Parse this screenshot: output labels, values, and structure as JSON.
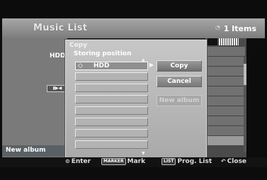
{
  "header": {
    "title": "Music List",
    "items_count": "1 Items"
  },
  "left": {
    "hdd": "HDD",
    "new_album": "New album"
  },
  "dialog": {
    "title": "Copy",
    "subtitle": "Storing position",
    "slots": [
      {
        "label": "HDD",
        "icon": "hdd-icon",
        "selected": true
      }
    ],
    "buttons": {
      "copy": "Copy",
      "cancel": "Cancel",
      "new_album": "New album"
    }
  },
  "footer": {
    "enter": "Enter",
    "mark_key": "MARKER",
    "mark": "Mark",
    "list_key": "LIST",
    "prog_list": "Prog. List",
    "close": "Close"
  }
}
